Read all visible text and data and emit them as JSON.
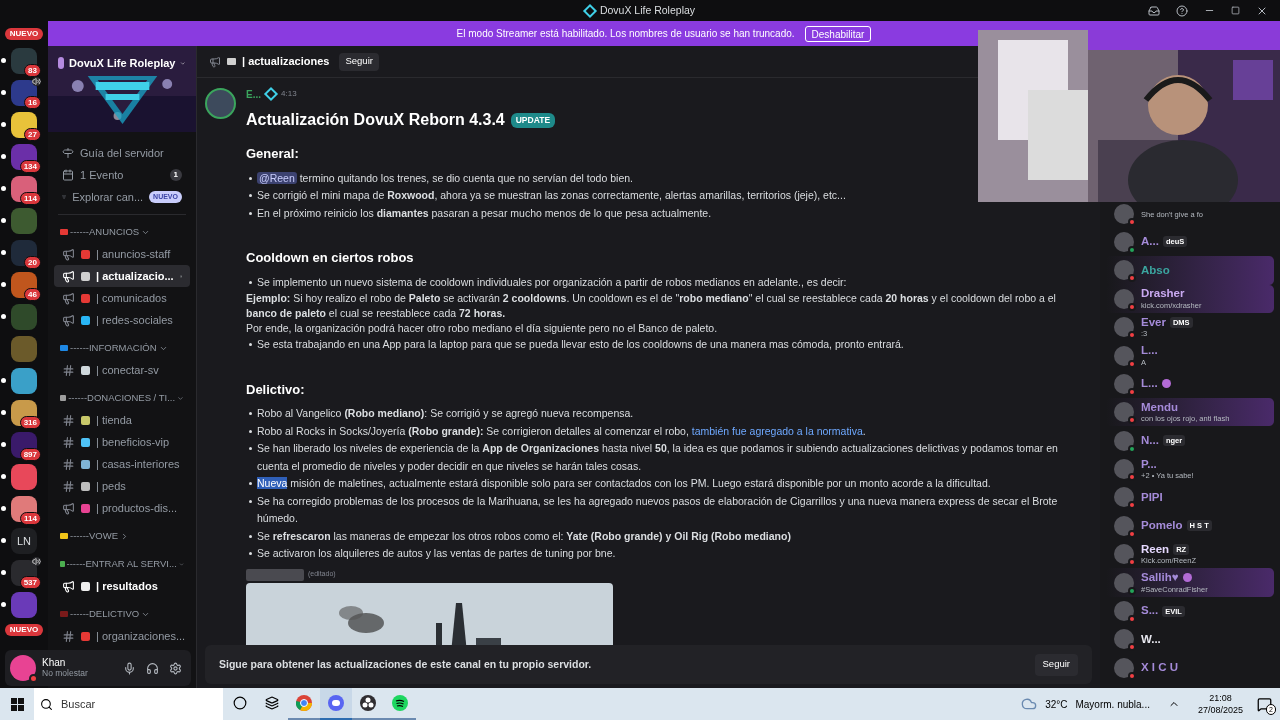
{
  "window": {
    "title": "DovuX Life Roleplay"
  },
  "streamer_banner": {
    "text": "El modo Streamer está habilitado. Los nombres de usuario se han truncado.",
    "button": "Deshabilitar"
  },
  "rail": {
    "top_pill": "NUEVO",
    "bottom_pill": "NUEVO",
    "servers": [
      {
        "color": "#2a3a3f",
        "badge": "83",
        "unread": true,
        "voice": false
      },
      {
        "color": "#2d3a8c",
        "badge": "16",
        "unread": true,
        "voice": true
      },
      {
        "color": "#e8c23a",
        "badge": "27",
        "unread": true,
        "voice": false
      },
      {
        "color": "#6b2fa8",
        "badge": "134",
        "unread": true,
        "voice": false
      },
      {
        "color": "#d9607a",
        "badge": "114",
        "unread": true,
        "voice": false
      },
      {
        "color": "#3d5a30",
        "unread": true,
        "voice": false
      },
      {
        "color": "#1f2a3a",
        "badge": "20",
        "unread": true,
        "voice": false
      },
      {
        "color": "#c0561d",
        "badge": "46",
        "unread": true,
        "voice": false
      },
      {
        "color": "#2f4a2a",
        "unread": true,
        "voice": false
      },
      {
        "color": "#6b5a2a",
        "unread": false,
        "voice": false
      },
      {
        "color": "#3aa0c8",
        "unread": true,
        "voice": false
      },
      {
        "color": "#c89a4a",
        "badge": "316",
        "unread": true,
        "voice": false
      },
      {
        "color": "#3a1a6a",
        "badge": "897",
        "unread": true,
        "voice": false
      },
      {
        "color": "#e8485a",
        "unread": true,
        "voice": false
      },
      {
        "color": "#e07a7a",
        "badge": "114",
        "unread": true,
        "voice": false
      },
      {
        "color": "#1e1f22",
        "label": "LN",
        "unread": true,
        "voice": false
      },
      {
        "color": "#2a2a2e",
        "badge": "537",
        "unread": true,
        "voice": true
      },
      {
        "color": "#6a3ab8",
        "unread": true,
        "voice": false
      }
    ]
  },
  "sidebar": {
    "server_name": "DovuX Life Roleplay",
    "guide_items": [
      {
        "kind": "guide",
        "label": "Guía del servidor"
      },
      {
        "kind": "events",
        "label": "1 Evento",
        "count": "1"
      },
      {
        "kind": "browse",
        "label": "Explorar can...",
        "badge": "NUEVO"
      }
    ],
    "categories": [
      {
        "name": "------ANUNCIOS",
        "color": "#e53935",
        "expanded": true,
        "channels": [
          {
            "kind": "announcement",
            "color": "#e53935",
            "name": "| anuncios-staff",
            "selected": false,
            "unread": false
          },
          {
            "kind": "announcement",
            "color": "#d0d0d0",
            "name": "| actualizacio...",
            "selected": true,
            "unread": false
          },
          {
            "kind": "announcement",
            "color": "#e53935",
            "name": "| comunicados",
            "selected": false,
            "unread": false
          },
          {
            "kind": "announcement",
            "color": "#29b6f6",
            "name": "| redes-sociales",
            "selected": false,
            "unread": false
          }
        ]
      },
      {
        "name": "------INFORMACIÓN",
        "color": "#1e88e5",
        "expanded": true,
        "channels": [
          {
            "kind": "text",
            "color": "#cfd8dc",
            "name": "| conectar-sv",
            "selected": false,
            "unread": false
          }
        ]
      },
      {
        "name": "------DONACIONES / TI...",
        "color": "#9e9e9e",
        "expanded": true,
        "channels": [
          {
            "kind": "text",
            "color": "#c8c86a",
            "name": "| tienda",
            "selected": false,
            "unread": false
          },
          {
            "kind": "text",
            "color": "#4fc3f7",
            "name": "| beneficios-vip",
            "selected": false,
            "unread": false
          },
          {
            "kind": "text",
            "color": "#7fb3d5",
            "name": "| casas-interiores",
            "selected": false,
            "unread": false
          },
          {
            "kind": "text",
            "color": "#bdbdbd",
            "name": "| peds",
            "selected": false,
            "unread": false
          },
          {
            "kind": "announcement",
            "color": "#e84393",
            "name": "| productos-dis...",
            "selected": false,
            "unread": false
          }
        ]
      },
      {
        "name": "------VOWE",
        "color": "#f0c419",
        "expanded": false
      },
      {
        "name": "------ENTRAR AL SERVI...",
        "color": "#4caf50",
        "expanded": true,
        "channels": [
          {
            "kind": "announcement",
            "color": "#eeeeee",
            "name": "| resultados",
            "selected": false,
            "unread": true
          }
        ]
      },
      {
        "name": "------DELICTIVO",
        "color": "#7a1a1a",
        "expanded": true,
        "channels": [
          {
            "kind": "text",
            "color": "#e53935",
            "name": "| organizaciones...",
            "selected": false,
            "unread": false
          }
        ]
      }
    ]
  },
  "user_panel": {
    "name": "Khan",
    "status": "No molestar"
  },
  "channel_header": {
    "name": "| actualizaciones",
    "button": "Seguir"
  },
  "message": {
    "author": "E...",
    "time": "4:13",
    "title": "Actualización DovuX Reborn 4.3.4",
    "badge": "UPDATE",
    "sections": [
      {
        "heading": "General:",
        "blocks": [
          {
            "kind": "bullet",
            "parts": [
              {
                "kind": "mention",
                "text": "@Reen"
              },
              {
                "kind": "text",
                "text": " termino quitando los trenes, se dio cuenta que no servían del todo bien."
              }
            ]
          },
          {
            "kind": "bullet",
            "text": "Se corrigió el mini mapa de **Roxwood**, ahora ya se muestran las zonas correctamente, alertas amarillas, territorios (jeje), etc..."
          },
          {
            "kind": "bullet",
            "text": "En el próximo reinicio los **diamantes** pasaran a pesar mucho menos de lo que pesa actualmente."
          }
        ]
      },
      {
        "heading": "Cooldown en ciertos robos",
        "blocks": [
          {
            "kind": "bullet",
            "text": "Se implemento un nuevo sistema de cooldown individuales por organización a partir de robos medianos en adelante., es decir:"
          },
          {
            "kind": "paragraph",
            "text": "**Ejemplo:** Si hoy realizo el robo de **Paleto** se activarán **2 cooldowns**. Un cooldown es el de \"**robo mediano**\" el cual se reestablece cada **20 horas** y el cooldown del robo a el **banco de paleto** el cual se reestablece cada **72 horas.**"
          },
          {
            "kind": "paragraph",
            "text": "Por ende, la organización podrá hacer otro robo mediano el día siguiente pero no el Banco de paleto."
          },
          {
            "kind": "bullet",
            "text": "Se esta trabajando en una App para la laptop para que se pueda llevar esto de los cooldowns de una manera mas cómoda, pronto entrará."
          }
        ]
      },
      {
        "heading": "Delictivo:",
        "blocks": [
          {
            "kind": "bullet",
            "text": "Robo al Vangelico **(Robo mediano)**: Se corrigió y se agregó nueva recompensa."
          },
          {
            "kind": "bullet",
            "parts": [
              {
                "kind": "text",
                "text": "Robo al Rocks in Socks/Joyería **(Robo grande):** Se corrigieron detalles al comenzar el robo, "
              },
              {
                "kind": "link",
                "text": "también fue agregado a la normativa"
              },
              {
                "kind": "text",
                "text": "."
              }
            ]
          },
          {
            "kind": "bullet",
            "text": "Se han liberado los niveles de experiencia de la **App de Organizaciones** hasta nivel **50**, la idea es que podamos ir subiendo actualizaciones delictivas y podamos tomar en cuenta el promedio de niveles y poder decidir en que niveles se harán tales cosas."
          },
          {
            "kind": "bullet",
            "parts": [
              {
                "kind": "selected",
                "text": "Nueva"
              },
              {
                "kind": "text",
                "text": " misión de maletines, actualmente estará disponible solo para ser contactados con los PM. Luego estará disponible por un monto acorde a la dificultad."
              }
            ]
          },
          {
            "kind": "bullet",
            "text": "Se ha corregido problemas de los procesos de la Marihuana, se les ha agregado nuevos pasos de elaboración de Cigarrillos y una nueva manera express de secar el Brote húmedo."
          },
          {
            "kind": "bullet",
            "text": "Se **refrescaron** las maneras de empezar los otros robos como el: **Yate (Robo grande) y Oil Rig (Robo mediano)**"
          },
          {
            "kind": "bullet",
            "text": "Se activaron los alquileres de autos y las ventas de partes de tuning por bne."
          }
        ]
      }
    ],
    "edited_label": "(editado)"
  },
  "footer": {
    "text": "Sigue para obtener las actualizaciones de este canal en tu propio servidor.",
    "button": "Seguir"
  },
  "members": [
    {
      "status_text": "She don't give a fo",
      "online": false,
      "nameplate": false
    },
    {
      "name": "A...",
      "color": "#a58bd9",
      "tag": {
        "text": "deuS"
      },
      "online": true,
      "nameplate": false
    },
    {
      "name": "Abso",
      "color": "#3ba59f",
      "online": false,
      "nameplate": true
    },
    {
      "name": "Drasher",
      "color": "#c9a9f0",
      "status_text": "kick.com/xdrasher",
      "online": false,
      "nameplate": true
    },
    {
      "name": "Ever",
      "color": "#a58bd9",
      "tag": {
        "text": "DMS"
      },
      "status_text": ":3",
      "online": false,
      "nameplate": false
    },
    {
      "name": "L...",
      "color": "#a58bd9",
      "status_text": "A",
      "online": false,
      "nameplate": false
    },
    {
      "name": "L...",
      "color": "#a58bd9",
      "tag": {
        "kind": "icon"
      },
      "online": false,
      "nameplate": false
    },
    {
      "name": "Mendu",
      "color": "#a58bd9",
      "status_text": "con los ojos rojo, anti flash",
      "online": false,
      "nameplate": true
    },
    {
      "name": "N...",
      "color": "#a58bd9",
      "tag": {
        "text": "nger"
      },
      "online": true,
      "nameplate": false
    },
    {
      "name": "P...",
      "color": "#a58bd9",
      "status_text": "+2 • Ya tu sabe!",
      "online": false,
      "nameplate": false
    },
    {
      "name": "PIPI",
      "color": "#a58bd9",
      "online": false,
      "nameplate": false
    },
    {
      "name": "Pomelo",
      "color": "#a58bd9",
      "tag": {
        "text": "H S T"
      },
      "online": false,
      "nameplate": false
    },
    {
      "name": "Reen",
      "color": "#e6d9ff",
      "tag": {
        "text": "RZ"
      },
      "status_text": "Kick.com/ReenZ",
      "online": false,
      "nameplate": false
    },
    {
      "name": "Sallih♥",
      "color": "#a58bd9",
      "tag": {
        "kind": "icon"
      },
      "status_text": "#SaveConradFisher",
      "online": true,
      "nameplate": true
    },
    {
      "name": "S...",
      "color": "#a58bd9",
      "tag": {
        "text": "EVIL"
      },
      "online": false,
      "nameplate": false
    },
    {
      "name": "W...",
      "color": "#e8e8f0",
      "online": false,
      "nameplate": false
    },
    {
      "name": "X I C U",
      "color": "#a58bd9",
      "online": false,
      "nameplate": false
    }
  ],
  "taskbar": {
    "search_placeholder": "Buscar",
    "apps": [
      {
        "kind": "cortana",
        "selected": false,
        "running": false
      },
      {
        "kind": "taskview",
        "selected": false,
        "running": false
      },
      {
        "kind": "chrome",
        "selected": false,
        "running": true
      },
      {
        "kind": "discord",
        "selected": true,
        "running": true
      },
      {
        "kind": "obs",
        "selected": false,
        "running": true
      },
      {
        "kind": "spotify",
        "selected": false,
        "running": true
      }
    ],
    "temperature": "32°C",
    "weather": "Mayorm. nubla...",
    "time": "21:08",
    "date": "27/08/2025",
    "notifications": "2"
  }
}
